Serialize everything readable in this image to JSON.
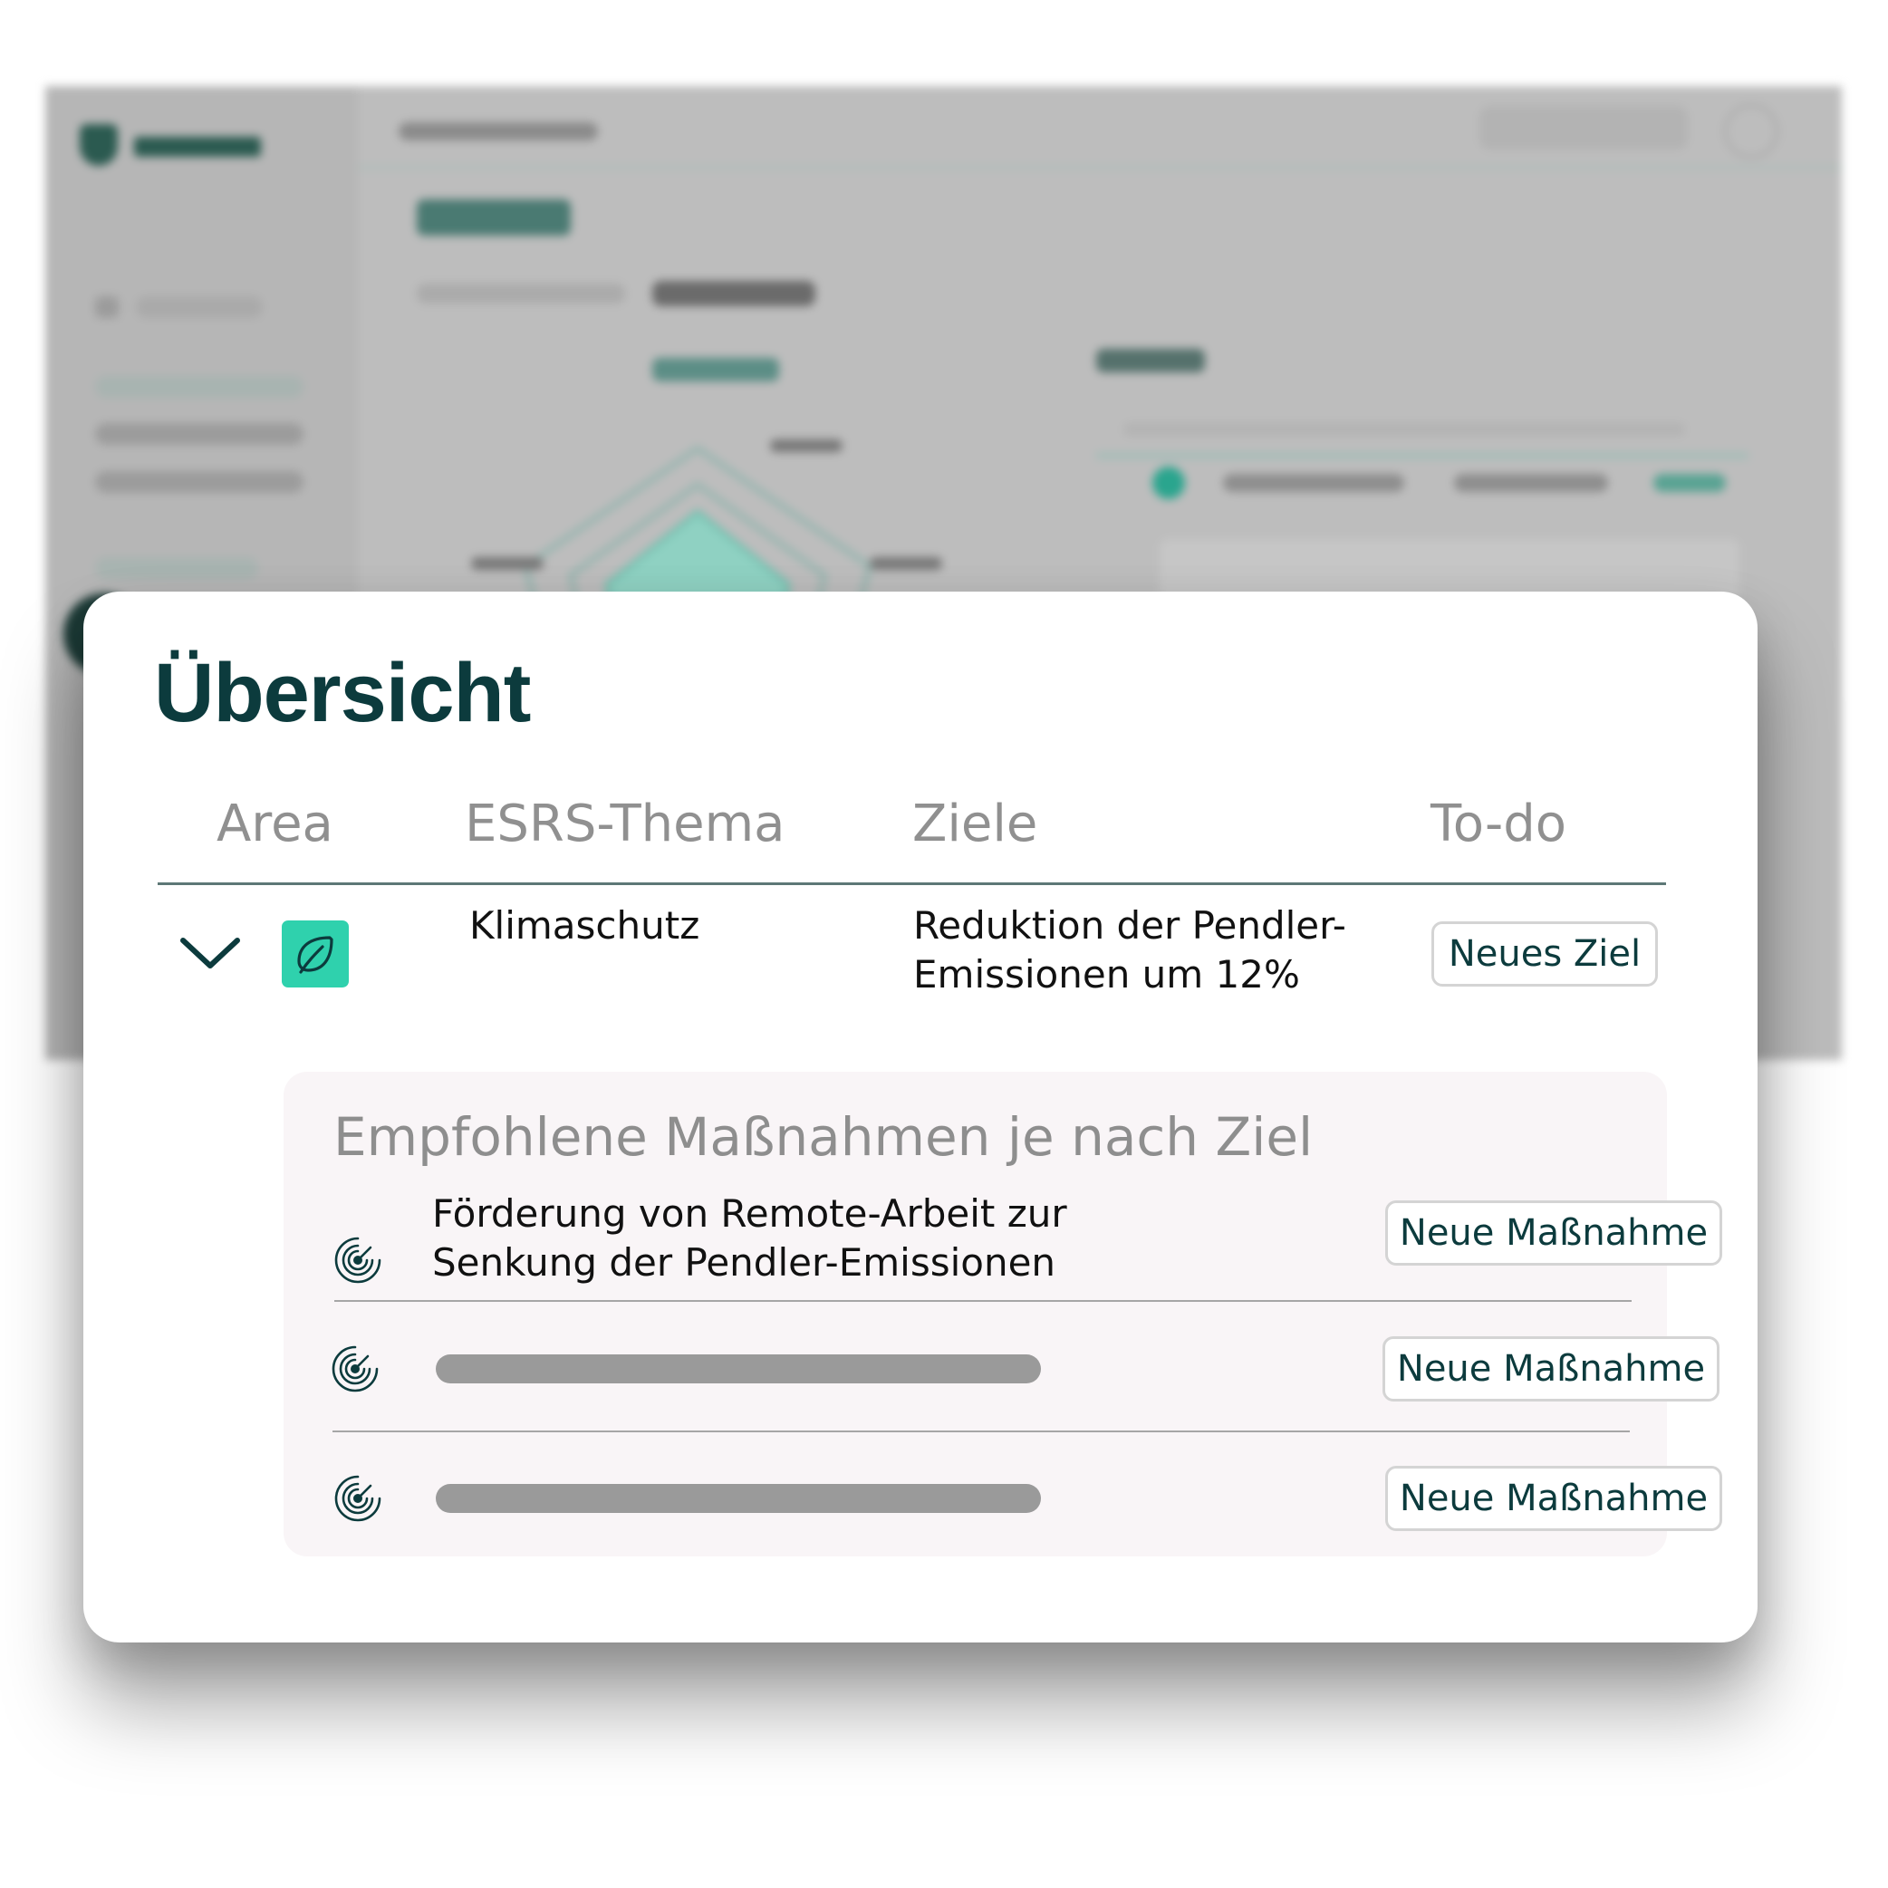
{
  "overview": {
    "title": "Übersicht",
    "columns": [
      "Area",
      "ESRS-Thema",
      "Ziele",
      "To-do"
    ],
    "row": {
      "area_icon": "leaf-icon",
      "esrs_topic": "Klimaschutz",
      "goal_line1": "Reduktion der Pendler-",
      "goal_line2": "Emissionen um 12%",
      "todo_button": "Neues Ziel"
    }
  },
  "recommendations": {
    "title": "Empfohlene Maßnahmen je nach Ziel",
    "items": [
      {
        "icon": "target-icon",
        "text_line1": "Förderung von Remote-Arbeit zur",
        "text_line2": "Senkung der Pendler-Emissionen",
        "button": "Neue Maßnahme"
      },
      {
        "icon": "target-icon",
        "placeholder": true,
        "button": "Neue Maßnahme"
      },
      {
        "icon": "target-icon",
        "placeholder": true,
        "button": "Neue Maßnahme"
      }
    ]
  },
  "colors": {
    "title": "#0c3b3d",
    "accent": "#2fd1ad",
    "panel_background": "#f9f5f7",
    "header_text": "#909090"
  }
}
